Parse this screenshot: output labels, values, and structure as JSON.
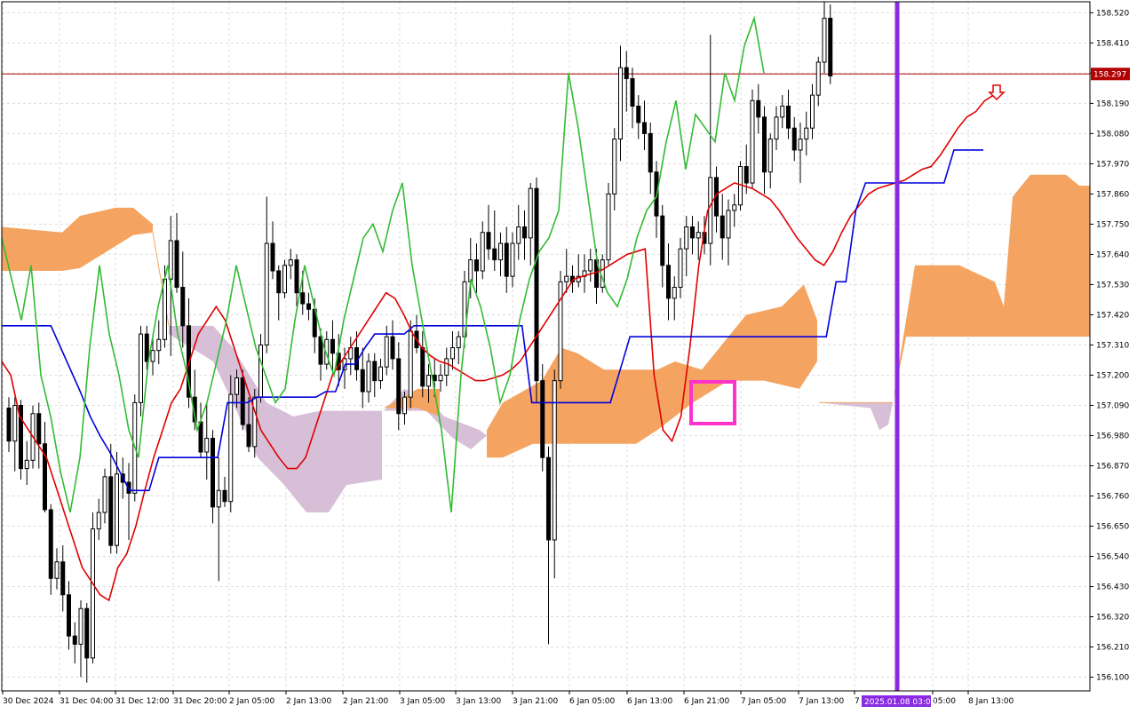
{
  "chart_data": {
    "type": "candlestick",
    "instrument_hint": "USDJPY H1 (Ichimoku)",
    "ylim": [
      156.05,
      158.56
    ],
    "y_ticks": [
      "158.520",
      "158.410",
      "158.300",
      "158.190",
      "158.080",
      "157.970",
      "157.860",
      "157.750",
      "157.640",
      "157.530",
      "157.420",
      "157.310",
      "157.200",
      "157.090",
      "156.980",
      "156.870",
      "156.760",
      "156.650",
      "156.540",
      "156.430",
      "156.320",
      "156.210",
      "156.100"
    ],
    "x_labels": [
      "30 Dec 2024",
      "31 Dec 04:00",
      "31 Dec 12:00",
      "31 Dec 20:00",
      "2 Jan 05:00",
      "2 Jan 13:00",
      "2 Jan 21:00",
      "3 Jan 05:00",
      "3 Jan 13:00",
      "3 Jan 21:00",
      "6 Jan 05:00",
      "6 Jan 13:00",
      "6 Jan 21:00",
      "7 Jan 05:00",
      "7 Jan 13:00",
      "7",
      "05:00",
      "8 Jan 13:00"
    ],
    "current_price": {
      "value": 158.297,
      "label": "158.297",
      "color": "#b20000"
    },
    "cursor_time_label": "2025.01.08 03:00",
    "candles": [
      [
        157.08,
        157.12,
        156.92,
        156.96
      ],
      [
        156.96,
        157.12,
        156.85,
        157.09
      ],
      [
        157.09,
        157.11,
        156.82,
        156.86
      ],
      [
        156.86,
        156.96,
        156.8,
        156.89
      ],
      [
        156.89,
        157.09,
        156.86,
        157.06
      ],
      [
        157.06,
        157.1,
        156.86,
        156.95
      ],
      [
        156.95,
        157.03,
        156.7,
        156.71
      ],
      [
        156.71,
        156.73,
        156.4,
        156.46
      ],
      [
        156.46,
        156.57,
        156.42,
        156.52
      ],
      [
        156.52,
        156.58,
        156.34,
        156.4
      ],
      [
        156.4,
        156.45,
        156.2,
        156.25
      ],
      [
        156.25,
        156.3,
        156.15,
        156.22
      ],
      [
        156.22,
        156.38,
        156.1,
        156.35
      ],
      [
        156.35,
        156.37,
        156.08,
        156.17
      ],
      [
        156.17,
        156.7,
        156.15,
        156.64
      ],
      [
        156.64,
        156.75,
        156.6,
        156.7
      ],
      [
        156.7,
        156.86,
        156.66,
        156.83
      ],
      [
        156.83,
        156.95,
        156.55,
        156.58
      ],
      [
        156.58,
        156.92,
        156.55,
        156.84
      ],
      [
        156.84,
        156.9,
        156.75,
        156.81
      ],
      [
        156.81,
        156.88,
        156.6,
        156.77
      ],
      [
        156.77,
        157.13,
        156.74,
        157.1
      ],
      [
        157.1,
        157.38,
        157.05,
        157.35
      ],
      [
        157.35,
        157.38,
        157.22,
        157.25
      ],
      [
        157.25,
        157.35,
        157.2,
        157.29
      ],
      [
        157.29,
        157.4,
        157.24,
        157.33
      ],
      [
        157.33,
        157.6,
        157.3,
        157.55
      ],
      [
        157.55,
        157.78,
        157.27,
        157.69
      ],
      [
        157.69,
        157.79,
        157.5,
        157.52
      ],
      [
        157.52,
        157.65,
        157.3,
        157.38
      ],
      [
        157.38,
        157.48,
        157.08,
        157.12
      ],
      [
        157.12,
        157.22,
        157.0,
        157.03
      ],
      [
        157.03,
        157.1,
        156.9,
        156.92
      ],
      [
        156.92,
        157.1,
        156.82,
        156.97
      ],
      [
        156.97,
        157.0,
        156.66,
        156.72
      ],
      [
        156.72,
        156.9,
        156.45,
        156.78
      ],
      [
        156.78,
        156.83,
        156.72,
        156.74
      ],
      [
        156.74,
        157.2,
        156.7,
        157.13
      ],
      [
        157.13,
        157.22,
        157.08,
        157.19
      ],
      [
        157.19,
        157.22,
        157.0,
        157.02
      ],
      [
        157.02,
        157.12,
        156.92,
        156.94
      ],
      [
        156.94,
        157.15,
        156.9,
        157.12
      ],
      [
        157.12,
        157.35,
        157.1,
        157.31
      ],
      [
        157.31,
        157.85,
        157.28,
        157.68
      ],
      [
        157.68,
        157.76,
        157.55,
        157.58
      ],
      [
        157.58,
        157.6,
        157.4,
        157.5
      ],
      [
        157.5,
        157.62,
        157.48,
        157.6
      ],
      [
        157.6,
        157.66,
        157.55,
        157.62
      ],
      [
        157.62,
        157.64,
        157.45,
        157.5
      ],
      [
        157.5,
        157.58,
        157.42,
        157.46
      ],
      [
        157.46,
        157.5,
        157.4,
        157.44
      ],
      [
        157.44,
        157.48,
        157.28,
        157.34
      ],
      [
        157.34,
        157.37,
        157.18,
        157.24
      ],
      [
        157.24,
        157.36,
        157.22,
        157.33
      ],
      [
        157.33,
        157.4,
        157.2,
        157.28
      ],
      [
        157.28,
        157.35,
        157.16,
        157.22
      ],
      [
        157.22,
        157.3,
        157.15,
        157.26
      ],
      [
        157.26,
        157.34,
        157.2,
        157.3
      ],
      [
        157.3,
        157.36,
        157.18,
        157.22
      ],
      [
        157.22,
        157.3,
        157.08,
        157.14
      ],
      [
        157.14,
        157.28,
        157.1,
        157.25
      ],
      [
        157.25,
        157.28,
        157.12,
        157.18
      ],
      [
        157.18,
        157.26,
        157.15,
        157.23
      ],
      [
        157.23,
        157.38,
        157.2,
        157.34
      ],
      [
        157.34,
        157.4,
        157.22,
        157.26
      ],
      [
        157.26,
        157.32,
        157.0,
        157.06
      ],
      [
        157.06,
        157.14,
        157.02,
        157.12
      ],
      [
        157.12,
        157.4,
        157.08,
        157.36
      ],
      [
        157.36,
        157.42,
        157.28,
        157.3
      ],
      [
        157.3,
        157.36,
        157.12,
        157.16
      ],
      [
        157.16,
        157.24,
        157.1,
        157.2
      ],
      [
        157.2,
        157.26,
        157.12,
        157.18
      ],
      [
        157.18,
        157.24,
        157.14,
        157.2
      ],
      [
        157.2,
        157.3,
        157.16,
        157.26
      ],
      [
        157.26,
        157.36,
        157.22,
        157.3
      ],
      [
        157.3,
        157.36,
        157.24,
        157.34
      ],
      [
        157.34,
        157.58,
        157.3,
        157.54
      ],
      [
        157.54,
        157.7,
        157.48,
        157.62
      ],
      [
        157.62,
        157.68,
        157.5,
        157.58
      ],
      [
        157.58,
        157.76,
        157.55,
        157.72
      ],
      [
        157.72,
        157.82,
        157.62,
        157.66
      ],
      [
        157.66,
        157.8,
        157.58,
        157.62
      ],
      [
        157.62,
        157.72,
        157.56,
        157.68
      ],
      [
        157.68,
        157.74,
        157.5,
        157.56
      ],
      [
        157.56,
        157.72,
        157.52,
        157.68
      ],
      [
        157.68,
        157.82,
        157.62,
        157.74
      ],
      [
        157.74,
        157.8,
        157.62,
        157.7
      ],
      [
        157.7,
        157.9,
        157.6,
        157.88
      ],
      [
        157.88,
        157.92,
        157.1,
        157.18
      ],
      [
        157.18,
        157.24,
        156.85,
        156.9
      ],
      [
        156.9,
        156.94,
        156.22,
        156.6
      ],
      [
        156.6,
        157.22,
        156.46,
        157.18
      ],
      [
        157.18,
        157.58,
        157.15,
        157.54
      ],
      [
        157.54,
        157.66,
        157.5,
        157.56
      ],
      [
        157.56,
        157.6,
        157.5,
        157.54
      ],
      [
        157.54,
        157.64,
        157.52,
        157.56
      ],
      [
        157.56,
        157.64,
        157.5,
        157.58
      ],
      [
        157.58,
        157.66,
        157.54,
        157.62
      ],
      [
        157.62,
        157.66,
        157.46,
        157.52
      ],
      [
        157.52,
        157.64,
        157.5,
        157.62
      ],
      [
        157.62,
        157.9,
        157.6,
        157.86
      ],
      [
        157.86,
        158.1,
        157.8,
        158.06
      ],
      [
        158.06,
        158.4,
        157.98,
        158.32
      ],
      [
        158.32,
        158.38,
        158.16,
        158.28
      ],
      [
        158.28,
        158.32,
        158.1,
        158.18
      ],
      [
        158.18,
        158.22,
        158.06,
        158.12
      ],
      [
        158.12,
        158.2,
        158.02,
        158.08
      ],
      [
        158.08,
        158.12,
        157.86,
        157.94
      ],
      [
        157.94,
        157.98,
        157.7,
        157.78
      ],
      [
        157.78,
        157.82,
        157.52,
        157.6
      ],
      [
        157.6,
        157.68,
        157.4,
        157.48
      ],
      [
        157.48,
        157.56,
        157.4,
        157.52
      ],
      [
        157.52,
        157.7,
        157.48,
        157.66
      ],
      [
        157.66,
        157.78,
        157.56,
        157.74
      ],
      [
        157.74,
        157.78,
        157.64,
        157.7
      ],
      [
        157.7,
        157.76,
        157.62,
        157.72
      ],
      [
        157.72,
        157.78,
        157.64,
        157.68
      ],
      [
        157.68,
        158.44,
        157.6,
        157.92
      ],
      [
        157.92,
        157.96,
        157.72,
        157.78
      ],
      [
        157.78,
        157.86,
        157.62,
        157.7
      ],
      [
        157.7,
        157.84,
        157.6,
        157.8
      ],
      [
        157.8,
        157.86,
        157.74,
        157.82
      ],
      [
        157.82,
        157.98,
        157.8,
        157.96
      ],
      [
        157.96,
        158.04,
        157.86,
        157.9
      ],
      [
        157.9,
        158.24,
        157.88,
        158.2
      ],
      [
        158.2,
        158.26,
        158.08,
        158.14
      ],
      [
        158.14,
        158.18,
        157.86,
        157.94
      ],
      [
        157.94,
        158.08,
        157.88,
        158.06
      ],
      [
        158.06,
        158.18,
        158.02,
        158.14
      ],
      [
        158.14,
        158.22,
        158.1,
        158.18
      ],
      [
        158.18,
        158.24,
        158.06,
        158.1
      ],
      [
        158.1,
        158.14,
        157.98,
        158.02
      ],
      [
        158.02,
        158.12,
        157.9,
        158.06
      ],
      [
        158.06,
        158.16,
        158.0,
        158.1
      ],
      [
        158.1,
        158.26,
        158.06,
        158.22
      ],
      [
        158.22,
        158.36,
        158.18,
        158.34
      ],
      [
        158.34,
        158.56,
        158.3,
        158.5
      ],
      [
        158.5,
        158.55,
        158.26,
        158.29
      ]
    ],
    "lines": [
      {
        "color": "#e00000",
        "values": [
          157.25,
          157.2,
          157.05,
          157.0,
          156.95,
          156.9,
          156.8,
          156.7,
          156.6,
          156.5,
          156.45,
          156.4,
          156.38,
          156.5,
          156.55,
          156.65,
          156.78,
          156.9,
          157.0,
          157.1,
          157.15,
          157.25,
          157.35,
          157.4,
          157.45,
          157.4,
          157.3,
          157.2,
          157.1,
          157.0,
          156.95,
          156.9,
          156.86,
          156.86,
          156.9,
          157.0,
          157.1,
          157.2,
          157.25,
          157.3,
          157.35,
          157.4,
          157.45,
          157.5,
          157.48,
          157.42,
          157.35,
          157.3,
          157.27,
          157.25,
          157.24,
          157.22,
          157.2,
          157.18,
          157.18,
          157.19,
          157.2,
          157.22,
          157.25,
          157.3,
          157.35,
          157.4,
          157.45,
          157.5,
          157.55,
          157.56,
          157.57,
          157.58,
          157.6,
          157.62,
          157.64,
          157.65,
          157.66,
          157.2,
          157.0,
          156.96,
          157.05,
          157.3,
          157.6,
          157.8,
          157.86,
          157.88,
          157.9,
          157.89,
          157.88,
          157.86,
          157.84,
          157.8,
          157.75,
          157.7,
          157.66,
          157.62,
          157.6,
          157.65,
          157.72,
          157.78,
          157.82,
          157.86,
          157.88,
          157.89,
          157.9,
          157.91,
          157.93,
          157.95,
          157.96,
          158.0,
          158.05,
          158.1,
          158.14,
          158.16,
          158.2,
          158.22
        ]
      },
      {
        "color": "#0000dd",
        "values": [
          157.38,
          157.38,
          157.38,
          157.38,
          157.38,
          157.38,
          157.3,
          157.22,
          157.14,
          157.05,
          156.98,
          156.92,
          156.85,
          156.78,
          156.78,
          156.78,
          156.9,
          156.9,
          156.9,
          156.9,
          156.9,
          156.9,
          156.9,
          157.1,
          157.1,
          157.1,
          157.12,
          157.12,
          157.12,
          157.12,
          157.12,
          157.12,
          157.12,
          157.14,
          157.14,
          157.24,
          157.24,
          157.3,
          157.35,
          157.35,
          157.35,
          157.35,
          157.38,
          157.38,
          157.38,
          157.38,
          157.38,
          157.38,
          157.38,
          157.38,
          157.38,
          157.38,
          157.38,
          157.38,
          157.1,
          157.1,
          157.1,
          157.1,
          157.1,
          157.1,
          157.1,
          157.1,
          157.1,
          157.22,
          157.34,
          157.34,
          157.34,
          157.34,
          157.34,
          157.34,
          157.34,
          157.34,
          157.34,
          157.34,
          157.34,
          157.34,
          157.34,
          157.34,
          157.34,
          157.34,
          157.34,
          157.34,
          157.34,
          157.34,
          157.34,
          157.54,
          157.54,
          157.8,
          157.9,
          157.9,
          157.9,
          157.9,
          157.9,
          157.9,
          157.9,
          157.9,
          157.9,
          158.02,
          158.02,
          158.02,
          158.02
        ]
      },
      {
        "color": "#33bb33",
        "values": [
          157.7,
          157.55,
          157.4,
          157.6,
          157.2,
          157.05,
          156.85,
          156.7,
          156.9,
          157.3,
          157.6,
          157.35,
          157.2,
          157.0,
          156.9,
          157.25,
          157.45,
          157.6,
          157.35,
          157.2,
          157.0,
          157.1,
          157.25,
          157.4,
          157.6,
          157.45,
          157.3,
          157.2,
          157.1,
          157.15,
          157.4,
          157.6,
          157.45,
          157.3,
          157.2,
          157.4,
          157.55,
          157.7,
          157.75,
          157.65,
          157.8,
          157.9,
          157.6,
          157.4,
          157.2,
          157.0,
          156.7,
          157.2,
          157.55,
          157.45,
          157.3,
          157.1,
          157.2,
          157.4,
          157.55,
          157.65,
          157.7,
          157.8,
          158.3,
          158.1,
          157.85,
          157.6,
          157.5,
          157.45,
          157.55,
          157.7,
          157.8,
          157.85,
          158.05,
          158.2,
          157.95,
          158.15,
          158.1,
          158.05,
          158.3,
          158.2,
          158.4,
          158.5,
          158.3
        ]
      }
    ]
  }
}
